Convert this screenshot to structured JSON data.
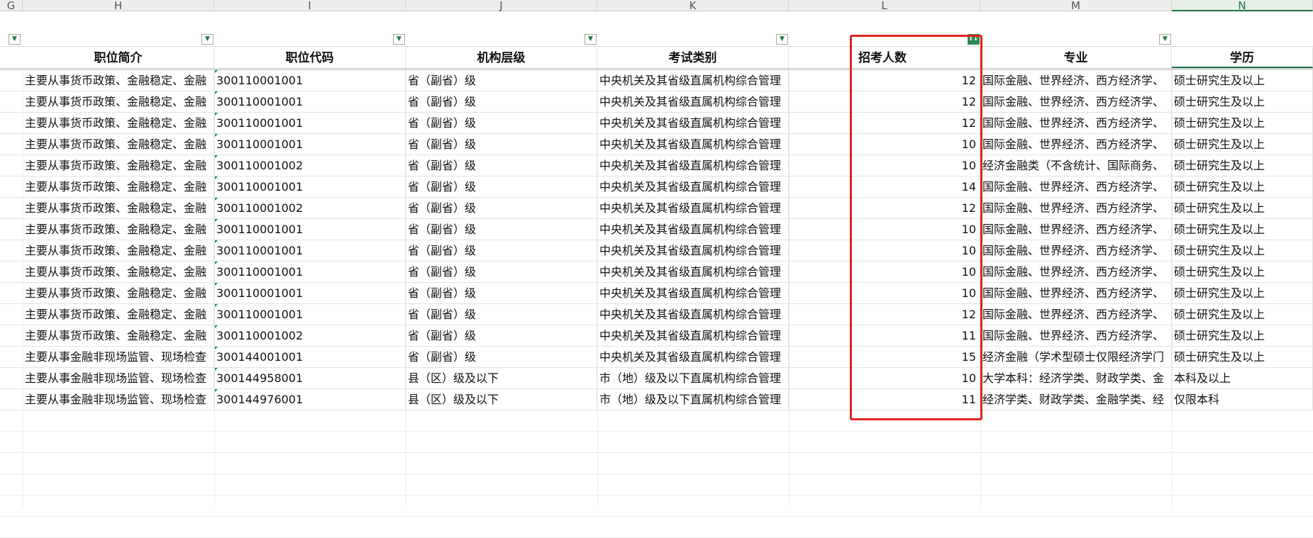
{
  "columns": [
    {
      "letter": "G"
    },
    {
      "letter": "H"
    },
    {
      "letter": "I"
    },
    {
      "letter": "J"
    },
    {
      "letter": "K"
    },
    {
      "letter": "L"
    },
    {
      "letter": "M"
    },
    {
      "letter": "N"
    }
  ],
  "headers": [
    "职位简介",
    "职位代码",
    "机构层级",
    "考试类别",
    "招考人数",
    "专业",
    "学历"
  ],
  "rows": [
    [
      "主要从事货币政策、金融稳定、金融",
      "300110001001",
      "省（副省）级",
      "中央机关及其省级直属机构综合管理",
      "12",
      "国际金融、世界经济、西方经济学、",
      "硕士研究生及以上"
    ],
    [
      "主要从事货币政策、金融稳定、金融",
      "300110001001",
      "省（副省）级",
      "中央机关及其省级直属机构综合管理",
      "12",
      "国际金融、世界经济、西方经济学、",
      "硕士研究生及以上"
    ],
    [
      "主要从事货币政策、金融稳定、金融",
      "300110001001",
      "省（副省）级",
      "中央机关及其省级直属机构综合管理",
      "12",
      "国际金融、世界经济、西方经济学、",
      "硕士研究生及以上"
    ],
    [
      "主要从事货币政策、金融稳定、金融",
      "300110001001",
      "省（副省）级",
      "中央机关及其省级直属机构综合管理",
      "10",
      "国际金融、世界经济、西方经济学、",
      "硕士研究生及以上"
    ],
    [
      "主要从事货币政策、金融稳定、金融",
      "300110001002",
      "省（副省）级",
      "中央机关及其省级直属机构综合管理",
      "10",
      "经济金融类（不含统计、国际商务、",
      "硕士研究生及以上"
    ],
    [
      "主要从事货币政策、金融稳定、金融",
      "300110001001",
      "省（副省）级",
      "中央机关及其省级直属机构综合管理",
      "14",
      "国际金融、世界经济、西方经济学、",
      "硕士研究生及以上"
    ],
    [
      "主要从事货币政策、金融稳定、金融",
      "300110001002",
      "省（副省）级",
      "中央机关及其省级直属机构综合管理",
      "12",
      "国际金融、世界经济、西方经济学、",
      "硕士研究生及以上"
    ],
    [
      "主要从事货币政策、金融稳定、金融",
      "300110001001",
      "省（副省）级",
      "中央机关及其省级直属机构综合管理",
      "10",
      "国际金融、世界经济、西方经济学、",
      "硕士研究生及以上"
    ],
    [
      "主要从事货币政策、金融稳定、金融",
      "300110001001",
      "省（副省）级",
      "中央机关及其省级直属机构综合管理",
      "10",
      "国际金融、世界经济、西方经济学、",
      "硕士研究生及以上"
    ],
    [
      "主要从事货币政策、金融稳定、金融",
      "300110001001",
      "省（副省）级",
      "中央机关及其省级直属机构综合管理",
      "10",
      "国际金融、世界经济、西方经济学、",
      "硕士研究生及以上"
    ],
    [
      "主要从事货币政策、金融稳定、金融",
      "300110001001",
      "省（副省）级",
      "中央机关及其省级直属机构综合管理",
      "10",
      "国际金融、世界经济、西方经济学、",
      "硕士研究生及以上"
    ],
    [
      "主要从事货币政策、金融稳定、金融",
      "300110001001",
      "省（副省）级",
      "中央机关及其省级直属机构综合管理",
      "12",
      "国际金融、世界经济、西方经济学、",
      "硕士研究生及以上"
    ],
    [
      "主要从事货币政策、金融稳定、金融",
      "300110001002",
      "省（副省）级",
      "中央机关及其省级直属机构综合管理",
      "11",
      "国际金融、世界经济、西方经济学、",
      "硕士研究生及以上"
    ],
    [
      "主要从事金融非现场监管、现场检查",
      "300144001001",
      "省（副省）级",
      "中央机关及其省级直属机构综合管理",
      "15",
      "经济金融（学术型硕士仅限经济学门",
      "硕士研究生及以上"
    ],
    [
      "主要从事金融非现场监管、现场检查",
      "300144958001",
      "县（区）级及以下",
      "市（地）级及以下直属机构综合管理",
      "10",
      "大学本科：经济学类、财政学类、金",
      "本科及以上"
    ],
    [
      "主要从事金融非现场监管、现场检查",
      "300144976001",
      "县（区）级及以下",
      "市（地）级及以下直属机构综合管理",
      "11",
      "经济学类、财政学类、金融学类、经",
      "仅限本科"
    ]
  ],
  "filter_icon": "filter-dropdown-icon",
  "sort_badge": "T↓",
  "colors": {
    "highlight": "#e0241a",
    "accent": "#217346"
  }
}
